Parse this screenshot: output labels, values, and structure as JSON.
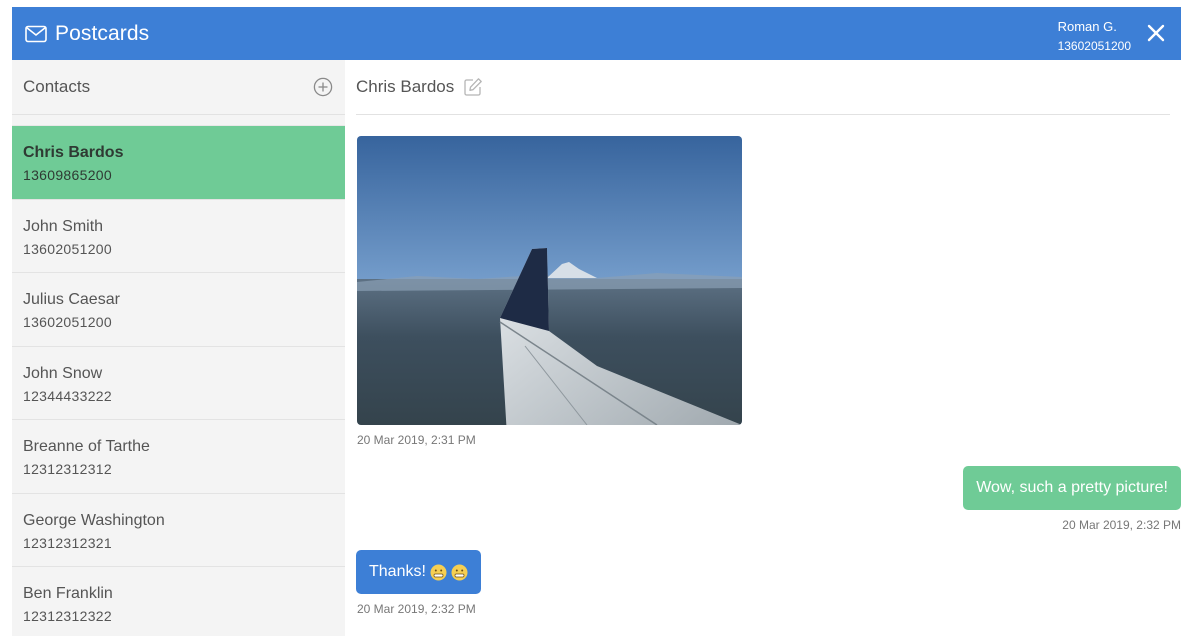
{
  "header": {
    "app_title": "Postcards",
    "user_name": "Roman G.",
    "user_phone": "13602051200",
    "color": "#3d7fd6"
  },
  "sidebar": {
    "title": "Contacts",
    "contacts": [
      {
        "name": "Chris Bardos",
        "phone": "13609865200",
        "active": true
      },
      {
        "name": "John Smith",
        "phone": "13602051200"
      },
      {
        "name": "Julius Caesar",
        "phone": "13602051200"
      },
      {
        "name": "John Snow",
        "phone": "12344433222"
      },
      {
        "name": "Breanne of Tarthe",
        "phone": "12312312312"
      },
      {
        "name": "George Washington",
        "phone": "12312312321"
      },
      {
        "name": "Ben Franklin",
        "phone": "12312312322"
      }
    ]
  },
  "conversation": {
    "contact_name": "Chris Bardos",
    "messages": [
      {
        "type": "image",
        "direction": "received",
        "timestamp": "20 Mar 2019, 2:31 PM"
      },
      {
        "type": "text",
        "direction": "sent",
        "text": "Wow, such a pretty picture!",
        "timestamp": "20 Mar 2019, 2:32 PM"
      },
      {
        "type": "text",
        "direction": "received",
        "text": "Thanks!",
        "emoji": [
          "grimace-emoji",
          "grimace-emoji"
        ],
        "timestamp": "20 Mar 2019, 2:32 PM"
      }
    ]
  },
  "colors": {
    "accent_blue": "#3d7fd6",
    "active_green": "#6fcb96",
    "sidebar_bg": "#f4f4f4"
  }
}
